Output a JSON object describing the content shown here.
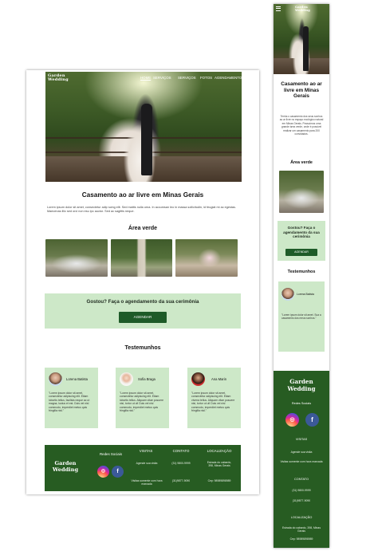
{
  "brand": {
    "name_line1": "Garden",
    "name_line2": "Wedding"
  },
  "nav": {
    "items": [
      "HOME",
      "SERVIÇOS",
      "SERVIÇOS",
      "FOTOS",
      "AGENDAMENTO"
    ]
  },
  "hero": {
    "title": "Casamento ao ar livre em Minas Gerais",
    "text": "Lorem ipsum dolor sit amet, consectetur adip scing elit. Sed mattis nulla urna. In accumsan leo in massa sollicitudin, id feugiat mi ac egestas. Maecenas illic sed orci non esu ipc auctor. Sed ac sagittis neque."
  },
  "green_area": {
    "title": "Área verde"
  },
  "cta": {
    "title": "Gostou? Faça o agendamento da sua cerimônia",
    "button": "AGENDAR"
  },
  "testimonials": {
    "title": "Testemunhos",
    "items": [
      {
        "name": "Lorena Batista",
        "quote": "\"Lorem ipsum dolor sit amet, consectetur adipiscing elit. Etiam lobortis tellus, facilisis neque ac ut magna, luctus et est. Duis vel nisl commodo, imperdiet metus quis fringilla nisl.\""
      },
      {
        "name": "Sofia Braga",
        "quote": "\"Lorem ipsum dolor sit amet, consectetur adipiscing elit. Etiam lobortis tellus. Aliquam vitae posuere nisi, tortor ut ut! Duis vel nisl commodo, imperdiet metus quis fringilla nisl.\""
      },
      {
        "name": "Ana Marin",
        "quote": "\"Lorem ipsum dolor sit amet, consectetur adipiscing elit. Etiam viverra tellus. Aliquam vitae posuere nisi, tortor ut ut! Duis vel nisl commodo, imperdiet metus quis fringilla nisl.\""
      }
    ]
  },
  "footer": {
    "social_title": "Redes Sociais",
    "visits_title": "VISITAS",
    "visits_line1": "Agende sua visita",
    "visits_line2": "Visitas somente com hora marcada",
    "contact_title": "CONTATO",
    "phone1": "(31) 9800-9999",
    "phone2": "(31)9877-9090",
    "location_title": "LOCALIZAÇÃO",
    "address": "Estrada do cabardo, 398, Minas Gerais",
    "cep": "Cep: 98989898989"
  },
  "mobile": {
    "hero_text": "Tenha o casamento dos seus sonhos ao ar livre no espaço ecológico natural em Minas Gerais. Possuímos uma grande área verde, onde é possível realizar um casamento para 200 convidados.",
    "testimonial_name": "Lorena Batista",
    "testimonial_quote": "\"Lorem ipsum dolor sit amet. Sua a casamento dos meus sonhos.\""
  },
  "icons": {
    "instagram": "instagram-icon",
    "facebook": "facebook-icon",
    "menu": "hamburger-menu-icon"
  },
  "colors": {
    "accent_green": "#1e5b28",
    "light_green": "#cde8c8",
    "footer_green": "#275c22"
  }
}
